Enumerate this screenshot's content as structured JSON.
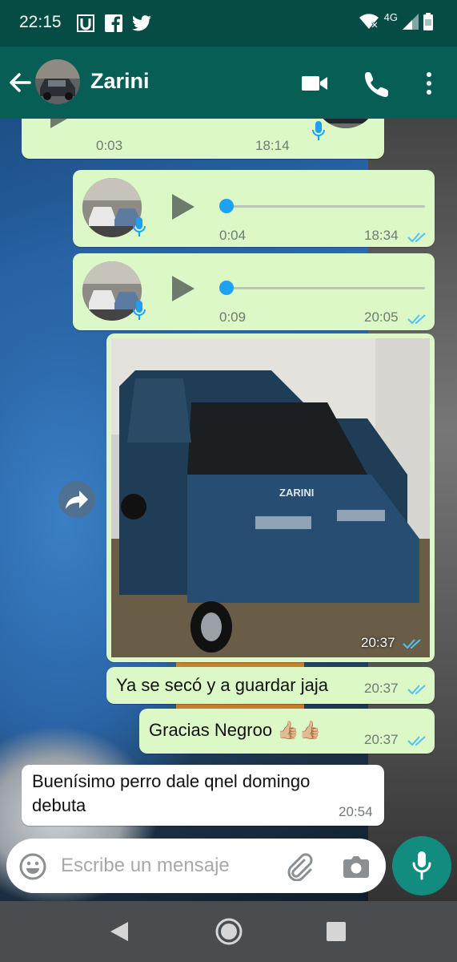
{
  "status_bar": {
    "time": "22:15",
    "network": "4G",
    "icons": [
      "u-app-icon",
      "facebook-icon",
      "twitter-icon",
      "wifi-icon",
      "signal-icon",
      "battery-icon"
    ]
  },
  "header": {
    "contact_name": "Zarini",
    "icons": [
      "back-arrow-icon",
      "video-call-icon",
      "phone-icon",
      "more-vert-icon"
    ]
  },
  "messages": [
    {
      "type": "voice",
      "direction": "out",
      "duration": "0:03",
      "time": "18:14",
      "partial": true
    },
    {
      "type": "voice",
      "direction": "out",
      "duration": "0:04",
      "time": "18:34",
      "read": true
    },
    {
      "type": "voice",
      "direction": "out",
      "duration": "0:09",
      "time": "20:05",
      "read": true
    },
    {
      "type": "image",
      "direction": "out",
      "time": "20:37",
      "read": true,
      "image_plate_text": "ZARINI"
    },
    {
      "type": "text",
      "direction": "out",
      "text": "Ya se secó y a guardar jaja",
      "time": "20:37",
      "read": true
    },
    {
      "type": "text",
      "direction": "out",
      "text": "Gracias Negroo 👍🏼👍🏼",
      "time": "20:37",
      "read": true
    },
    {
      "type": "text",
      "direction": "in",
      "text": "Buenísimo perro dale qnel domingo debuta",
      "time": "20:54"
    }
  ],
  "composer": {
    "placeholder": "Escribe un mensaje"
  },
  "colors": {
    "header": "#075e54",
    "status_bar": "#054d44",
    "outgoing_bubble": "#dcf8c6",
    "incoming_bubble": "#ffffff",
    "read_ticks": "#4fc3f7",
    "fab": "#128c7e"
  }
}
